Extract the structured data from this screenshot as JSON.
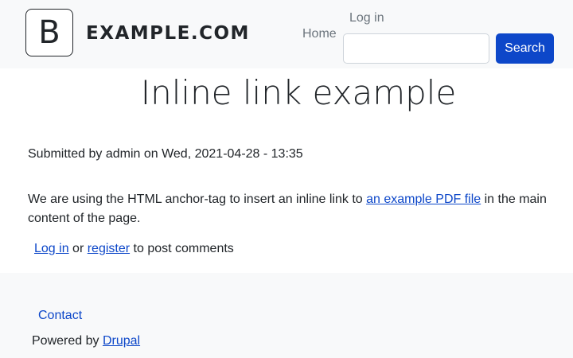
{
  "header": {
    "logo_letter": "B",
    "site_name": "EXAMPLE.COM",
    "nav": {
      "login": "Log in",
      "home": "Home"
    },
    "search": {
      "value": "",
      "placeholder": "",
      "button_label": "Search"
    }
  },
  "main": {
    "title": "Inline link example",
    "submitted": "Submitted by admin on Wed, 2021-04-28 - 13:35",
    "content": {
      "before": "We are using the HTML anchor-tag to insert an inline link to ",
      "link_text": "an example PDF file",
      "after": " in the main content of the page."
    },
    "comments": {
      "login": "Log in",
      "or": " or ",
      "register": "register",
      "suffix": " to post comments"
    }
  },
  "footer": {
    "contact": "Contact",
    "powered_by": "Powered by ",
    "drupal": "Drupal"
  },
  "colors": {
    "accent": "#0d47c9",
    "header_bg": "#f8f9fa",
    "text": "#212529",
    "muted": "#6c757d"
  }
}
